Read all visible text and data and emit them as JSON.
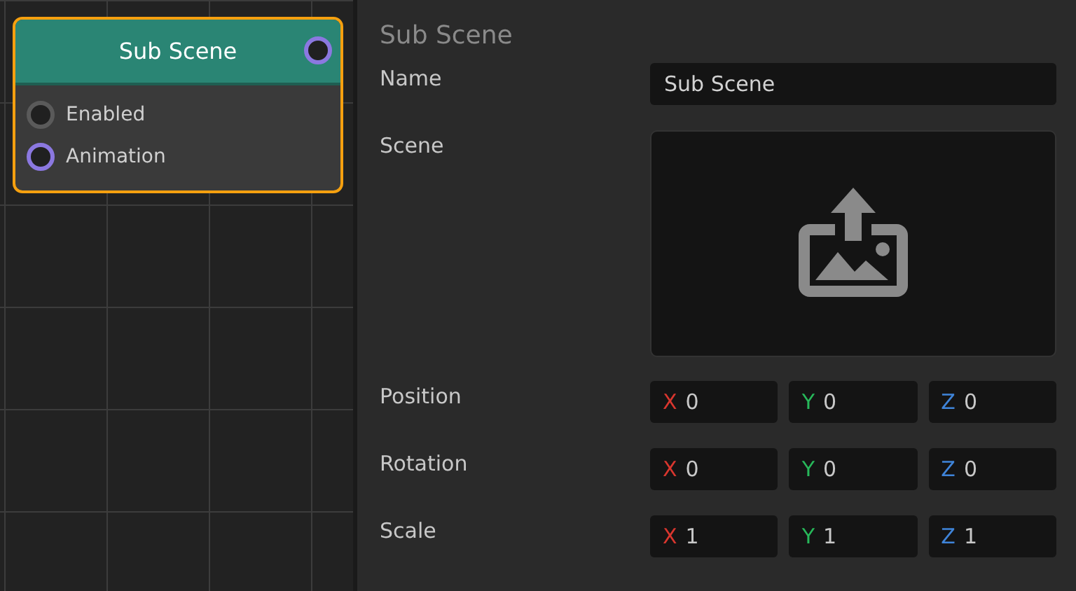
{
  "node": {
    "title": "Sub Scene",
    "output_port": {
      "color": "#8b78e0"
    },
    "inputs": [
      {
        "label": "Enabled",
        "color": "#5a5a5a"
      },
      {
        "label": "Animation",
        "color": "#8b78e0"
      }
    ]
  },
  "inspector": {
    "title": "Sub Scene",
    "name": {
      "label": "Name",
      "value": "Sub Scene"
    },
    "scene": {
      "label": "Scene"
    },
    "vectors": [
      {
        "label": "Position",
        "components": [
          {
            "axis": "X",
            "value": "0",
            "color": "#d9362e"
          },
          {
            "axis": "Y",
            "value": "0",
            "color": "#27b85a"
          },
          {
            "axis": "Z",
            "value": "0",
            "color": "#3f84d9"
          }
        ]
      },
      {
        "label": "Rotation",
        "components": [
          {
            "axis": "X",
            "value": "0",
            "color": "#d9362e"
          },
          {
            "axis": "Y",
            "value": "0",
            "color": "#27b85a"
          },
          {
            "axis": "Z",
            "value": "0",
            "color": "#3f84d9"
          }
        ]
      },
      {
        "label": "Scale",
        "components": [
          {
            "axis": "X",
            "value": "1",
            "color": "#d9362e"
          },
          {
            "axis": "Y",
            "value": "1",
            "color": "#27b85a"
          },
          {
            "axis": "Z",
            "value": "1",
            "color": "#3f84d9"
          }
        ]
      }
    ]
  }
}
